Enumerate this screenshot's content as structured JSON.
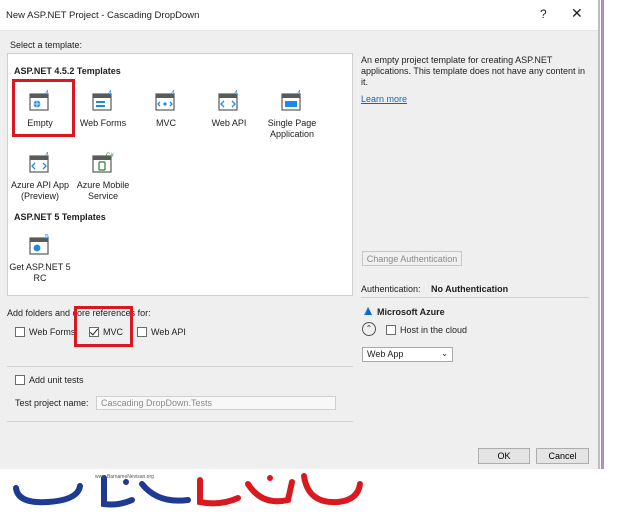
{
  "window": {
    "title": "New ASP.NET Project - Cascading DropDown",
    "help_label": "?",
    "close_label": "✕"
  },
  "select_template_label": "Select a template:",
  "groups": [
    {
      "heading": "ASP.NET 4.5.2 Templates"
    },
    {
      "heading": "ASP.NET 5 Templates"
    }
  ],
  "templates": [
    {
      "label": "Empty",
      "badge": "4",
      "icon": "web-template-icon",
      "selected": true
    },
    {
      "label": "Web Forms",
      "badge": "4",
      "icon": "web-forms-icon"
    },
    {
      "label": "MVC",
      "badge": "4",
      "icon": "mvc-icon"
    },
    {
      "label": "Web API",
      "badge": "4",
      "icon": "web-api-icon"
    },
    {
      "label": "Single Page Application",
      "badge": "4",
      "icon": "spa-icon"
    },
    {
      "label": "Azure API App (Preview)",
      "badge": "4",
      "icon": "azure-api-icon"
    },
    {
      "label": "Azure Mobile Service",
      "badge": "C#",
      "icon": "azure-mobile-icon"
    },
    {
      "label": "Get ASP.NET 5 RC",
      "badge": "5",
      "icon": "aspnet5-icon"
    }
  ],
  "description": {
    "text": "An empty project template for creating ASP.NET applications. This template does not have any content in it.",
    "learn_more": "Learn more"
  },
  "change_auth_label": "Change Authentication",
  "auth": {
    "label": "Authentication:",
    "value": "No Authentication"
  },
  "azure": {
    "heading": "Microsoft Azure",
    "host_label": "Host in the cloud",
    "dropdown_value": "Web App"
  },
  "folders": {
    "label": "Add folders and core references for:",
    "options": [
      {
        "label": "Web Forms",
        "checked": false
      },
      {
        "label": "MVC",
        "checked": true
      },
      {
        "label": "Web API",
        "checked": false
      }
    ]
  },
  "unit_tests": {
    "label": "Add unit tests",
    "checked": false
  },
  "test_project": {
    "label": "Test project name:",
    "value": "Cascading DropDown.Tests"
  },
  "ok_label": "OK",
  "cancel_label": "Cancel",
  "watermark": {
    "url": "www.BarnameNevisan.org"
  },
  "colors": {
    "selection": "#d9181f",
    "link": "#1565c0",
    "logo_blue": "#1f3a93",
    "logo_red": "#d9181f"
  }
}
